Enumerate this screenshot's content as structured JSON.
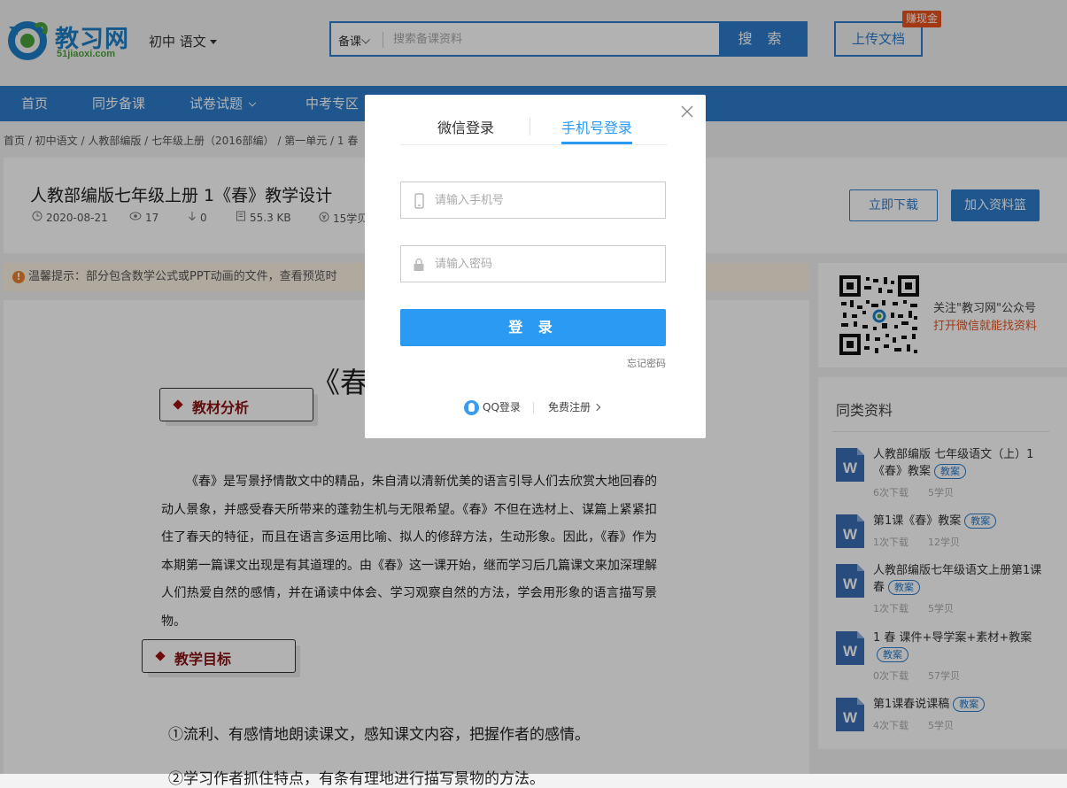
{
  "header": {
    "logo_text": "教习网",
    "logo_domain": "51jiaoxi.com",
    "subject": "初中 语文",
    "search_type": "备课",
    "search_placeholder": "搜索备课资料",
    "search_button": "搜 索",
    "upload_button": "上传文档",
    "earn_badge": "赚现金"
  },
  "nav": {
    "items": [
      "首页",
      "同步备课",
      "试卷试题",
      "中考专区"
    ]
  },
  "breadcrumb": "首页 / 初中语文 / 人教部编版 / 七年级上册（2016部编） / 第一单元 / 1 春",
  "document": {
    "title": "人教部编版七年级上册 1《春》教学设计",
    "date": "2020-08-21",
    "views": "17",
    "downloads": "0",
    "size": "55.3 KB",
    "price": "15学贝",
    "download_button": "立即下载",
    "basket_button": "加入资料篮"
  },
  "notice": {
    "icon": "!",
    "text": "温馨提示：部分包含数学公式或PPT动画的文件，查看预览时"
  },
  "preview": {
    "big_title": "《春",
    "section1": "教材分析",
    "paragraph": "《春》是写景抒情散文中的精品，朱自清以清新优美的语言引导人们去欣赏大地回春的动人景象，并感受春天所带来的蓬勃生机与无限希望。《春》不但在选材上、谋篇上紧紧扣住了春天的特征，而且在语言多运用比喻、拟人的修辞方法，生动形象。因此，《春》作为本期第一篇课文出现是有其道理的。由《春》这一课开始，继而学习后几篇课文来加深理解人们热爱自然的感情，并在诵读中体会、学习观察自然的方法，学会用形象的语言描写景物。",
    "section2": "教学目标",
    "goal1": "①流利、有感情地朗读课文，感知课文内容，把握作者的感情。",
    "goal2": "②学习作者抓住特点，有条有理地进行描写景物的方法。"
  },
  "qr": {
    "line1": "关注\"教习网\"公众号",
    "line2": "打开微信就能找资料"
  },
  "similar": {
    "title": "同类资料",
    "items": [
      {
        "title": "人教部编版 七年级语文（上）1《春》教案",
        "tag": "教案",
        "downloads": "6次下载",
        "price": "5学贝"
      },
      {
        "title": "第1课《春》教案",
        "tag": "教案",
        "downloads": "1次下载",
        "price": "12学贝"
      },
      {
        "title": "人教部编版七年级语文上册第1课 春",
        "tag": "教案",
        "downloads": "1次下载",
        "price": "5学贝"
      },
      {
        "title": "1 春 课件+导学案+素材+教案",
        "tag": "教案",
        "downloads": "0次下载",
        "price": "57学贝"
      },
      {
        "title": "第1课春说课稿",
        "tag": "教案",
        "downloads": "4次下载",
        "price": "5学贝"
      }
    ]
  },
  "modal": {
    "tab_wechat": "微信登录",
    "tab_phone": "手机号登录",
    "phone_placeholder": "请输入手机号",
    "password_placeholder": "请输入密码",
    "login_button": "登 录",
    "forgot": "忘记密码",
    "qq_login": "QQ登录",
    "register": "免费注册",
    "active_tab": "tab_phone"
  },
  "colors": {
    "brand_blue": "#2b7ccb",
    "login_blue": "#2b9af3",
    "accent_orange": "#e8521e",
    "section_red": "#8a1010"
  },
  "icons": {
    "phone": "phone-icon",
    "lock": "lock-icon",
    "close": "close-icon",
    "qq": "qq-icon",
    "word": "word-doc-icon"
  }
}
